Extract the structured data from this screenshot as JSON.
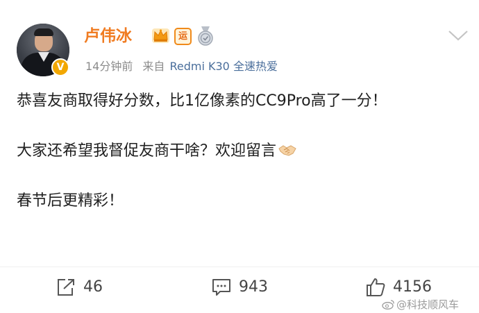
{
  "post": {
    "author": {
      "name": "卢伟冰",
      "verified_mark": "V",
      "badge_text": "运"
    },
    "meta": {
      "time": "14分钟前",
      "source_prefix": "来自",
      "source_device": "Redmi K30 全速热爱"
    },
    "content": {
      "line1": "恭喜友商取得好分数，比1亿像素的CC9Pro高了一分！",
      "line2": "大家还希望我督促友商干啥？欢迎留言",
      "line3": "春节后更精彩！"
    },
    "actions": {
      "repost_count": "46",
      "comment_count": "943",
      "like_count": "4156"
    }
  },
  "watermark": {
    "text": "@科技顺风车"
  },
  "colors": {
    "name": "#f07c22",
    "source_link": "#4a6e9b",
    "verified_badge": "#f2a700",
    "meta_gray": "#8c8c8c"
  },
  "icons": [
    "crown-icon",
    "yun-badge",
    "medal-icon",
    "chevron-down-icon",
    "handshake-icon",
    "repost-icon",
    "comment-icon",
    "like-icon",
    "weibo-logo-icon"
  ]
}
